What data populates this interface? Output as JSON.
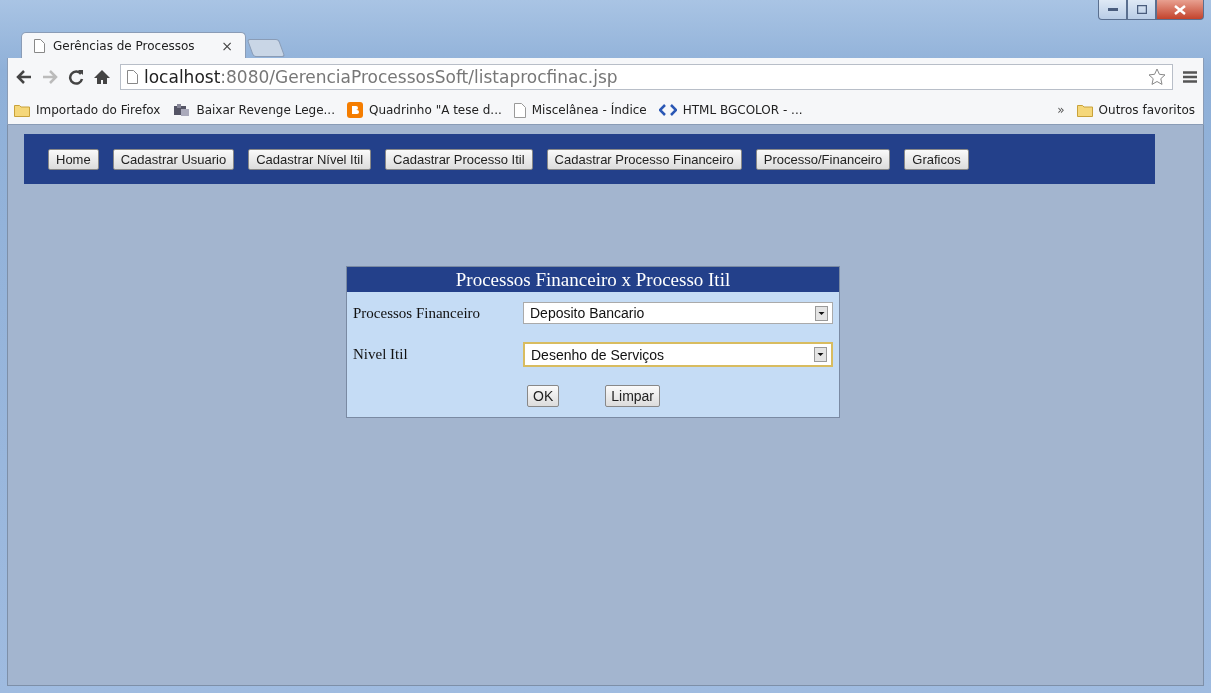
{
  "browser": {
    "tabs": [
      {
        "title": "Gerências de Processos",
        "close": "×",
        "selected": true
      }
    ],
    "address": {
      "host": "localhost",
      "rest": ":8080/GerenciaProcessosSoft/listaprocfinac.jsp"
    },
    "bookmarks": [
      {
        "kind": "folder",
        "label": "Importado do Firefox"
      },
      {
        "kind": "app",
        "label": "Baixar Revenge Lege..."
      },
      {
        "kind": "blogger",
        "label": "Quadrinho \"A tese d..."
      },
      {
        "kind": "page",
        "label": "Miscelânea - Índice"
      },
      {
        "kind": "code",
        "label": "HTML BGCOLOR - ..."
      }
    ],
    "bookmarks_overflow": "»",
    "other_bookmarks": "Outros favoritos"
  },
  "nav": {
    "buttons": [
      "Home",
      "Cadastrar Usuario",
      "Cadastrar Nível Itil",
      "Cadastrar Processo Itil",
      "Cadastrar Processo Financeiro",
      "Processo/Financeiro",
      "Graficos"
    ]
  },
  "form": {
    "title": "Processos Financeiro x Processo Itil",
    "fields": [
      {
        "label": "Processos Financeiro",
        "value": "Deposito Bancario",
        "focused": false
      },
      {
        "label": "Nivel Itil",
        "value": "Desenho de Serviços",
        "focused": true
      }
    ],
    "buttons": [
      "OK",
      "Limpar"
    ]
  }
}
